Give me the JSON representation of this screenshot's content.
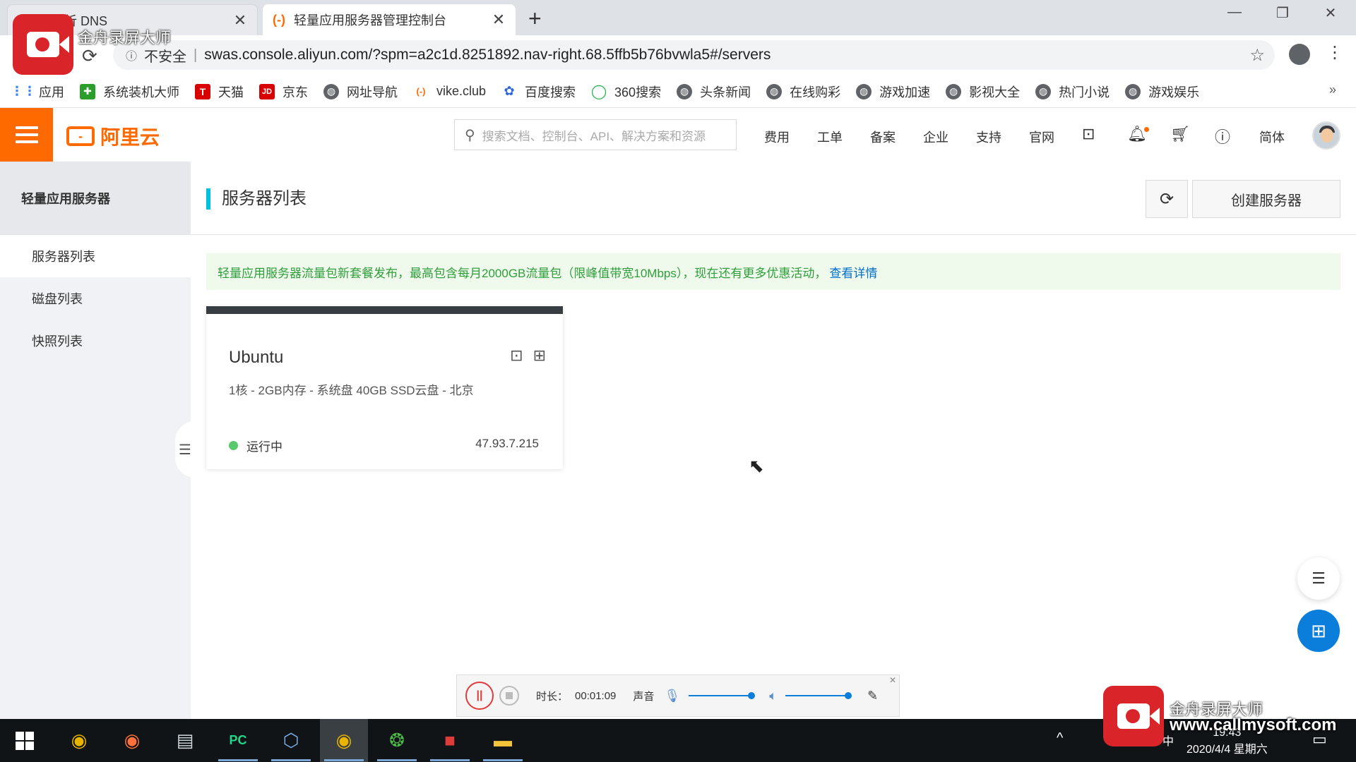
{
  "browser": {
    "tabs": [
      {
        "title": "云解析 DNS",
        "favicon": "aliyun-icon"
      },
      {
        "title": "轻量应用服务器管理控制台",
        "favicon": "aliyun-icon"
      }
    ],
    "security_label": "不安全",
    "url": "swas.console.aliyun.com/?spm=a2c1d.8251892.nav-right.68.5ffb5b76bvwla5#/servers"
  },
  "bookmarks": [
    {
      "label": "应用",
      "icon": "apps-grid-icon"
    },
    {
      "label": "系统装机大师",
      "icon": "green-cross-icon"
    },
    {
      "label": "天猫",
      "icon": "tmall-icon"
    },
    {
      "label": "京东",
      "icon": "jd-icon"
    },
    {
      "label": "网址导航",
      "icon": "globe-icon"
    },
    {
      "label": "vike.club",
      "icon": "aliyun-icon"
    },
    {
      "label": "百度搜索",
      "icon": "baidu-paw-icon"
    },
    {
      "label": "360搜索",
      "icon": "360-icon"
    },
    {
      "label": "头条新闻",
      "icon": "globe-icon"
    },
    {
      "label": "在线购彩",
      "icon": "globe-icon"
    },
    {
      "label": "游戏加速",
      "icon": "globe-icon"
    },
    {
      "label": "影视大全",
      "icon": "globe-icon"
    },
    {
      "label": "热门小说",
      "icon": "globe-icon"
    },
    {
      "label": "游戏娱乐",
      "icon": "globe-icon"
    }
  ],
  "header": {
    "logo_text": "阿里云",
    "search_placeholder": "搜索文档、控制台、API、解决方案和资源",
    "nav": [
      "费用",
      "工单",
      "备案",
      "企业",
      "支持",
      "官网"
    ],
    "lang": "简体",
    "accent": "#ff6a00"
  },
  "sidebar": {
    "title": "轻量应用服务器",
    "items": [
      {
        "label": "服务器列表",
        "active": true
      },
      {
        "label": "磁盘列表",
        "active": false
      },
      {
        "label": "快照列表",
        "active": false
      }
    ]
  },
  "main": {
    "page_title": "服务器列表",
    "create_label": "创建服务器",
    "notice": {
      "text": "轻量应用服务器流量包新套餐发布，最高包含每月2000GB流量包（限峰值带宽10Mbps），现在还有更多优惠活动，",
      "link": "查看详情"
    },
    "servers": [
      {
        "name": "Ubuntu",
        "spec": "1核 - 2GB内存 - 系统盘 40GB SSD云盘 - 北京",
        "status": "运行中",
        "ip": "47.93.7.215"
      }
    ]
  },
  "recorder": {
    "duration_label": "时长：",
    "duration": "00:01:09",
    "sound_label": "声音"
  },
  "taskbar": {
    "time": "19:43",
    "date": "2020/4/4 星期六",
    "ime": "中"
  },
  "watermark": {
    "brand": "金舟录屏大师",
    "url": "www.callmysoft.com"
  }
}
